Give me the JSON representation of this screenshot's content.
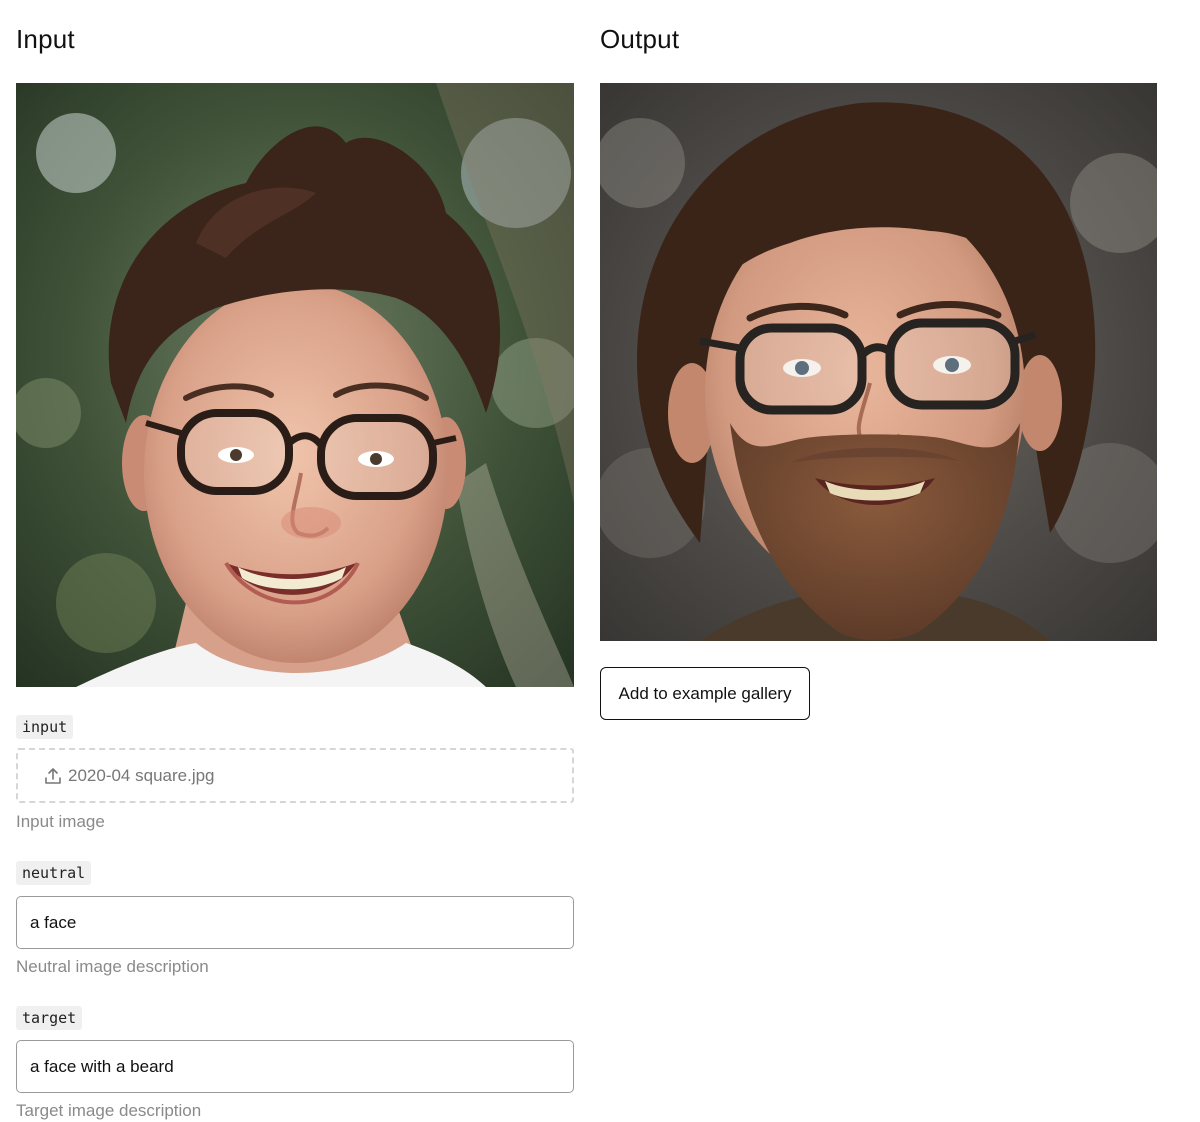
{
  "input_panel": {
    "heading": "Input",
    "image_alt": "Smiling young man with glasses and messy brown hair, trees in background",
    "fields": {
      "input": {
        "tag": "input",
        "filename": "2020-04 square.jpg",
        "help": "Input image",
        "icon": "upload-icon"
      },
      "neutral": {
        "tag": "neutral",
        "value": "a face",
        "help": "Neutral image description"
      },
      "target": {
        "tag": "target",
        "value": "a face with a beard",
        "help": "Target image description"
      }
    }
  },
  "output_panel": {
    "heading": "Output",
    "image_alt": "Smiling man with glasses, brown hair and a full beard",
    "gallery_button_label": "Add to example gallery"
  },
  "colors": {
    "text": "#111111",
    "muted_text": "#8a8a8a",
    "tag_background": "#f0f0f0",
    "dropzone_border": "#d6d6d6",
    "field_border": "#9a9a9a"
  }
}
